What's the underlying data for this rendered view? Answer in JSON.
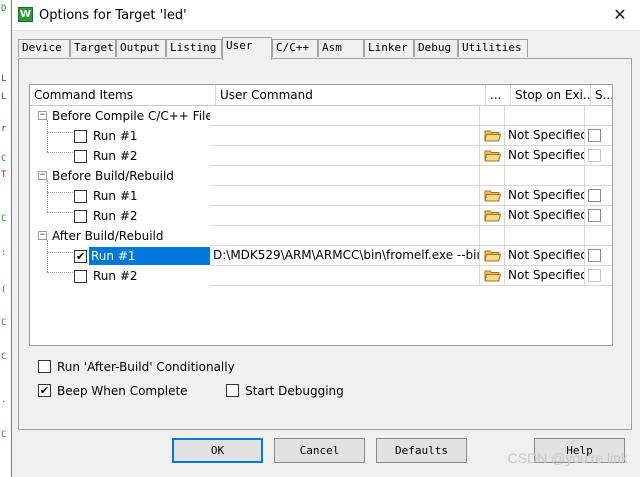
{
  "dialog": {
    "title": "Options for Target 'led'",
    "app_icon_letter": "W",
    "close_glyph": "✕"
  },
  "tabs": [
    {
      "label": "Device",
      "active": false
    },
    {
      "label": "Target",
      "active": false
    },
    {
      "label": "Output",
      "active": false
    },
    {
      "label": "Listing",
      "active": false
    },
    {
      "label": "User",
      "active": true
    },
    {
      "label": "C/C++",
      "active": false
    },
    {
      "label": "Asm",
      "active": false
    },
    {
      "label": "Linker",
      "active": false
    },
    {
      "label": "Debug",
      "active": false
    },
    {
      "label": "Utilities",
      "active": false
    }
  ],
  "grid": {
    "columns": {
      "command_items": "Command Items",
      "user_command": "User Command",
      "browse": "...",
      "stop_on_exit": "Stop on Exi...",
      "s": "S..."
    },
    "groups": [
      {
        "label": "Before Compile C/C++ File",
        "expander": "−",
        "runs": [
          {
            "label": "Run #1",
            "checked": false,
            "selected": false,
            "command": "",
            "stop_on_exit": "Not Specified"
          },
          {
            "label": "Run #2",
            "checked": false,
            "selected": false,
            "command": "",
            "stop_on_exit": "Not Specified"
          }
        ]
      },
      {
        "label": "Before Build/Rebuild",
        "expander": "−",
        "runs": [
          {
            "label": "Run #1",
            "checked": false,
            "selected": false,
            "command": "",
            "stop_on_exit": "Not Specified"
          },
          {
            "label": "Run #2",
            "checked": false,
            "selected": false,
            "command": "",
            "stop_on_exit": "Not Specified"
          }
        ]
      },
      {
        "label": "After Build/Rebuild",
        "expander": "−",
        "runs": [
          {
            "label": "Run #1",
            "checked": true,
            "selected": true,
            "command": "D:\\MDK529\\ARM\\ARMCC\\bin\\fromelf.exe --bin...",
            "stop_on_exit": "Not Specified"
          },
          {
            "label": "Run #2",
            "checked": false,
            "selected": false,
            "command": "",
            "stop_on_exit": "Not Specified"
          }
        ]
      }
    ]
  },
  "options": {
    "run_after_build_conditionally": {
      "label": "Run 'After-Build' Conditionally",
      "checked": false
    },
    "beep_when_complete": {
      "label": "Beep When Complete",
      "checked": true
    },
    "start_debugging": {
      "label": "Start Debugging",
      "checked": false
    }
  },
  "buttons": {
    "ok": "OK",
    "cancel": "Cancel",
    "defaults": "Defaults",
    "help": "Help"
  },
  "watermark": "CSDN @you're link",
  "icons": {
    "folder": "folder-open-icon",
    "check": "✔"
  }
}
